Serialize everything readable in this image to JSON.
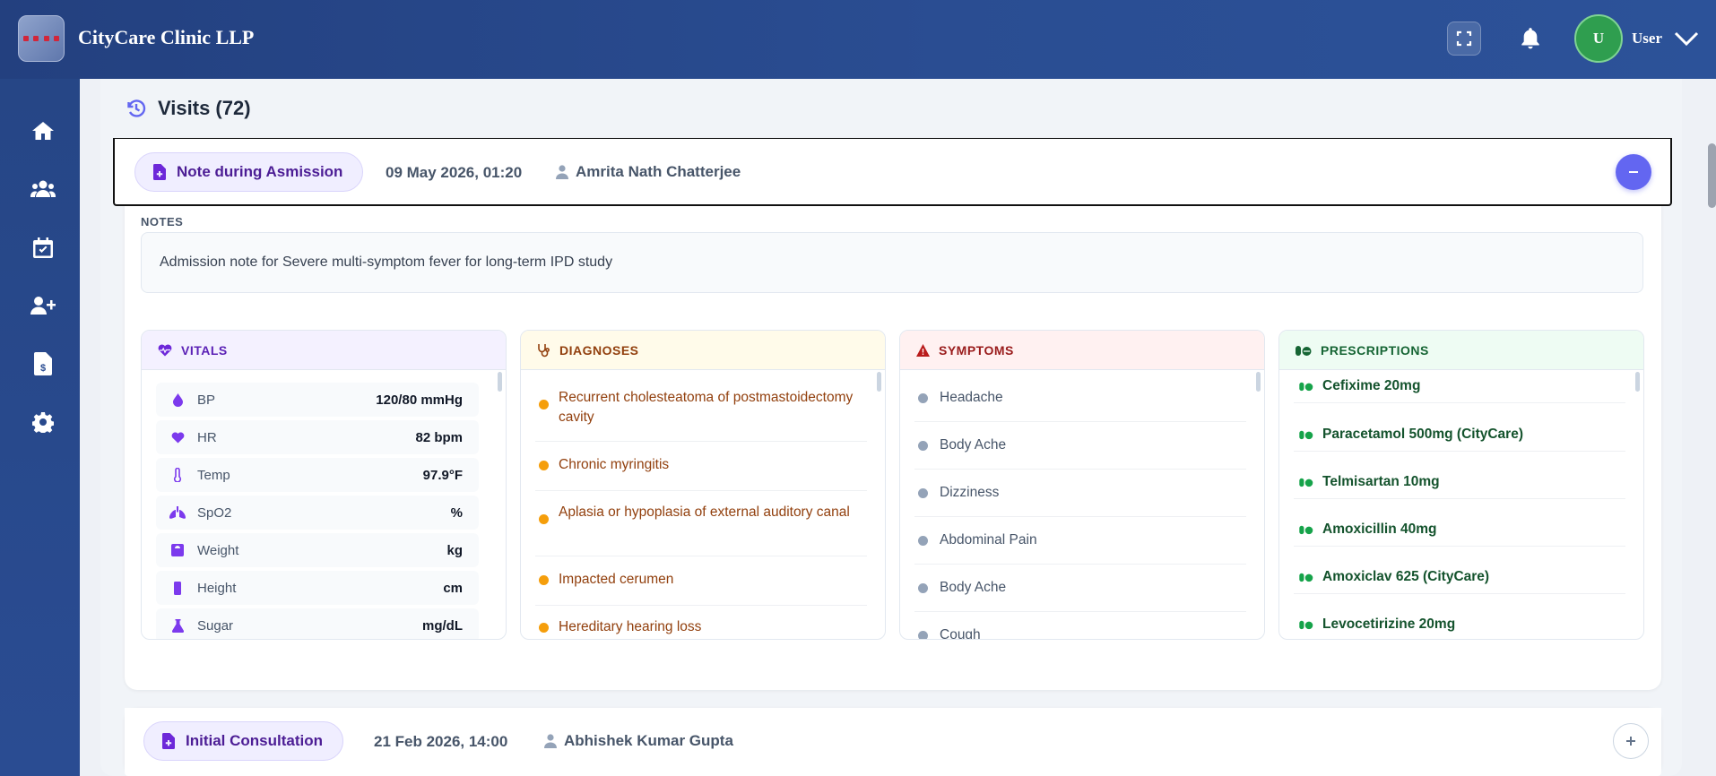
{
  "app": {
    "brand": "CityCare Clinic LLP",
    "user_initial": "U",
    "user_label": "User"
  },
  "sidebar": {
    "items": [
      {
        "name": "home",
        "icon": "home-icon"
      },
      {
        "name": "patients",
        "icon": "users-icon"
      },
      {
        "name": "appointments",
        "icon": "calendar-check-icon"
      },
      {
        "name": "add-user",
        "icon": "user-plus-icon"
      },
      {
        "name": "billing",
        "icon": "invoice-icon"
      },
      {
        "name": "settings",
        "icon": "gear-icon"
      }
    ]
  },
  "visits": {
    "title": "Visits (72)",
    "visit1": {
      "type": "Note during Asmission",
      "date": "09 May 2026, 01:20",
      "doctor": "Amrita Nath Chatterjee",
      "notes_label": "NOTES",
      "notes": "Admission note for Severe multi-symptom fever for long-term IPD study",
      "vitals_title": "VITALS",
      "vitals": [
        {
          "name": "BP",
          "value": "120/80 mmHg"
        },
        {
          "name": "HR",
          "value": "82 bpm"
        },
        {
          "name": "Temp",
          "value": "97.9°F"
        },
        {
          "name": "SpO2",
          "value": "%"
        },
        {
          "name": "Weight",
          "value": "kg"
        },
        {
          "name": "Height",
          "value": "cm"
        },
        {
          "name": "Sugar",
          "value": "mg/dL"
        }
      ],
      "diagnoses_title": "DIAGNOSES",
      "diagnoses": [
        "Recurrent cholesteatoma of postmastoidectomy cavity",
        "Chronic myringitis",
        "Aplasia or hypoplasia of external auditory canal",
        "Impacted cerumen",
        "Hereditary hearing loss"
      ],
      "symptoms_title": "SYMPTOMS",
      "symptoms": [
        "Headache",
        "Body Ache",
        "Dizziness",
        "Abdominal Pain",
        "Body Ache",
        "Cough"
      ],
      "prescriptions_title": "PRESCRIPTIONS",
      "prescriptions": [
        "Cefixime 20mg",
        "Paracetamol 500mg (CityCare)",
        "Telmisartan 10mg",
        "Amoxicillin 40mg",
        "Amoxiclav 625 (CityCare)",
        "Levocetirizine 20mg"
      ]
    },
    "visit2": {
      "type": "Initial Consultation",
      "date": "21 Feb 2026, 14:00",
      "doctor": "Abhishek Kumar Gupta"
    }
  },
  "colors": {
    "header": "#23407f",
    "accent": "#6366f1",
    "diag_dot": "#f59e0b",
    "symp_dot": "#94a3b8",
    "rx_icon": "#16a34a"
  }
}
